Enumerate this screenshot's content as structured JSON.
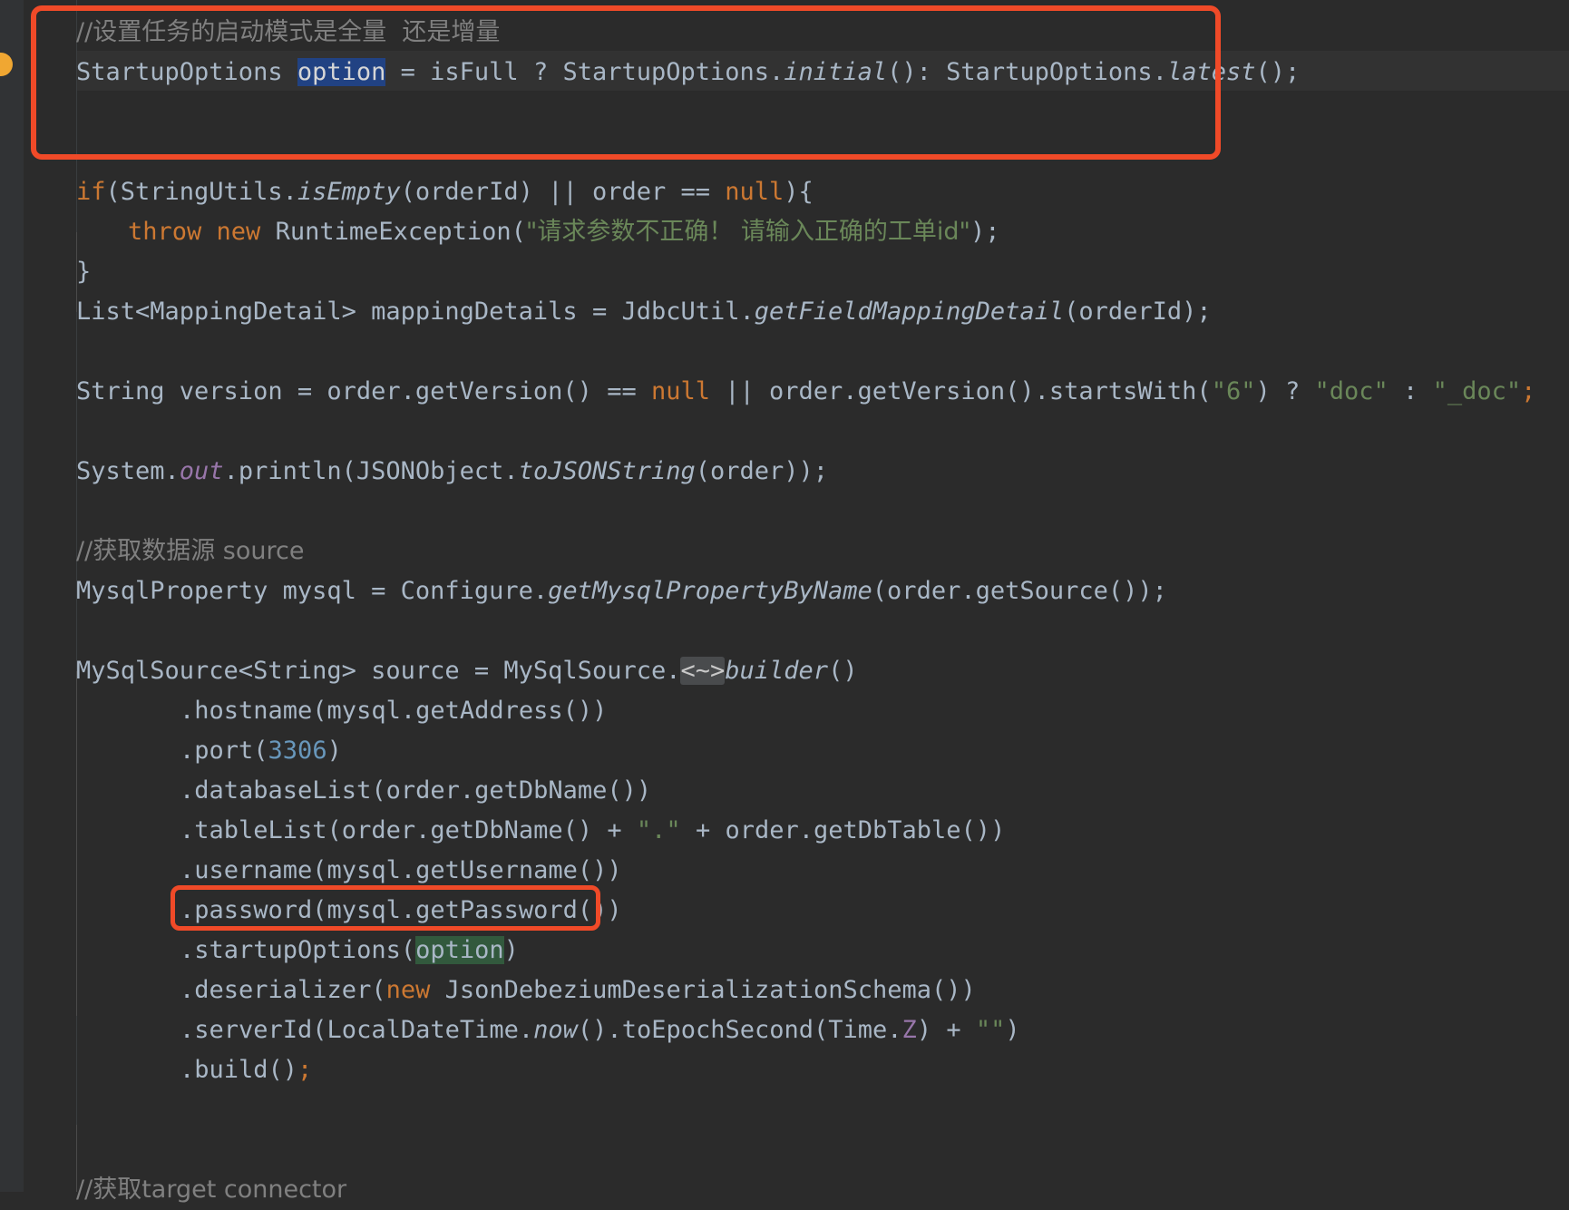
{
  "editor": {
    "theme": "darcula",
    "background": "#2b2b2b",
    "foreground": "#a9b7c6",
    "annotation_color": "#f04a28",
    "selection_color": "#214283",
    "occurrence_color": "#32593d"
  },
  "annotations": [
    {
      "name": "startup-mode-block",
      "label": ""
    },
    {
      "name": "startup-options-call",
      "label": ""
    }
  ],
  "gutter": {
    "intention_bulb_icon": "lightbulb-icon"
  },
  "lines": [
    {
      "indent": 0,
      "tokens": [
        {
          "t": "//设置任务的启动模式是全量  还是增量",
          "c": "cmt"
        }
      ]
    },
    {
      "indent": 0,
      "tokens": [
        {
          "t": "StartupOptions ",
          "c": "ident"
        },
        {
          "t": "option",
          "c": "sel"
        },
        {
          "t": " = isFull ? StartupOptions.",
          "c": "ident"
        },
        {
          "t": "initial",
          "c": "mth"
        },
        {
          "t": "(): StartupOptions.",
          "c": "ident"
        },
        {
          "t": "latest",
          "c": "mth"
        },
        {
          "t": "();",
          "c": "ident"
        }
      ]
    },
    {
      "indent": 0,
      "tokens": []
    },
    {
      "indent": 0,
      "tokens": []
    },
    {
      "indent": 0,
      "tokens": [
        {
          "t": "if",
          "c": "kw"
        },
        {
          "t": "(StringUtils.",
          "c": "ident"
        },
        {
          "t": "isEmpty",
          "c": "mth"
        },
        {
          "t": "(orderId) || order == ",
          "c": "ident"
        },
        {
          "t": "null",
          "c": "kw"
        },
        {
          "t": "){",
          "c": "ident"
        }
      ]
    },
    {
      "indent": 1,
      "tokens": [
        {
          "t": "throw new ",
          "c": "kw"
        },
        {
          "t": "RuntimeException(",
          "c": "ident"
        },
        {
          "t": "\"请求参数不正确！ 请输入正确的工单id\"",
          "c": "str"
        },
        {
          "t": ");",
          "c": "ident"
        }
      ]
    },
    {
      "indent": 0,
      "tokens": [
        {
          "t": "}",
          "c": "ident"
        }
      ]
    },
    {
      "indent": 0,
      "tokens": [
        {
          "t": "List<MappingDetail> mappingDetails = JdbcUtil.",
          "c": "ident"
        },
        {
          "t": "getFieldMappingDetail",
          "c": "mth"
        },
        {
          "t": "(orderId);",
          "c": "ident"
        }
      ]
    },
    {
      "indent": 0,
      "tokens": []
    },
    {
      "indent": 0,
      "tokens": [
        {
          "t": "String version = order.getVersion() == ",
          "c": "ident"
        },
        {
          "t": "null",
          "c": "kw"
        },
        {
          "t": " || order.getVersion().startsWith(",
          "c": "ident"
        },
        {
          "t": "\"6\"",
          "c": "str"
        },
        {
          "t": ") ? ",
          "c": "ident"
        },
        {
          "t": "\"doc\"",
          "c": "str"
        },
        {
          "t": " : ",
          "c": "ident"
        },
        {
          "t": "\"_doc\"",
          "c": "str"
        },
        {
          "t": ";",
          "c": "kw"
        }
      ]
    },
    {
      "indent": 0,
      "tokens": []
    },
    {
      "indent": 0,
      "tokens": [
        {
          "t": "System.",
          "c": "ident"
        },
        {
          "t": "out",
          "c": "stat"
        },
        {
          "t": ".println(JSONObject.",
          "c": "ident"
        },
        {
          "t": "toJSONString",
          "c": "mth"
        },
        {
          "t": "(order));",
          "c": "ident"
        }
      ]
    },
    {
      "indent": 0,
      "tokens": []
    },
    {
      "indent": 0,
      "tokens": [
        {
          "t": "//获取数据源 source",
          "c": "cmt"
        }
      ]
    },
    {
      "indent": 0,
      "tokens": [
        {
          "t": "MysqlProperty mysql = Configure.",
          "c": "ident"
        },
        {
          "t": "getMysqlPropertyByName",
          "c": "mth"
        },
        {
          "t": "(order.getSource());",
          "c": "ident"
        }
      ]
    },
    {
      "indent": 0,
      "tokens": []
    },
    {
      "indent": 0,
      "tokens": [
        {
          "t": "MySqlSource<String> source = MySqlSource.",
          "c": "ident"
        },
        {
          "t": "<~>",
          "c": "hint"
        },
        {
          "t": "builder",
          "c": "mth"
        },
        {
          "t": "()",
          "c": "ident"
        }
      ]
    },
    {
      "indent": 2,
      "tokens": [
        {
          "t": ".hostname(mysql.getAddress())",
          "c": "ident"
        }
      ]
    },
    {
      "indent": 2,
      "tokens": [
        {
          "t": ".port(",
          "c": "ident"
        },
        {
          "t": "3306",
          "c": "num"
        },
        {
          "t": ")",
          "c": "ident"
        }
      ]
    },
    {
      "indent": 2,
      "tokens": [
        {
          "t": ".databaseList(order.getDbName())",
          "c": "ident"
        }
      ]
    },
    {
      "indent": 2,
      "tokens": [
        {
          "t": ".tableList(order.getDbName() + ",
          "c": "ident"
        },
        {
          "t": "\".\"",
          "c": "str"
        },
        {
          "t": " + order.getDbTable())",
          "c": "ident"
        }
      ]
    },
    {
      "indent": 2,
      "tokens": [
        {
          "t": ".username(mysql.getUsername())",
          "c": "ident"
        }
      ]
    },
    {
      "indent": 2,
      "tokens": [
        {
          "t": ".password(mysql.getPassword())",
          "c": "ident"
        }
      ]
    },
    {
      "indent": 2,
      "tokens": [
        {
          "t": ".startupOptions(",
          "c": "ident"
        },
        {
          "t": "option",
          "c": "occ"
        },
        {
          "t": ")",
          "c": "ident"
        }
      ]
    },
    {
      "indent": 2,
      "tokens": [
        {
          "t": ".deserializer(",
          "c": "ident"
        },
        {
          "t": "new ",
          "c": "kw"
        },
        {
          "t": "JsonDebeziumDeserializationSchema())",
          "c": "ident"
        }
      ]
    },
    {
      "indent": 2,
      "tokens": [
        {
          "t": ".serverId(LocalDateTime.",
          "c": "ident"
        },
        {
          "t": "now",
          "c": "mth"
        },
        {
          "t": "().toEpochSecond(Time.",
          "c": "ident"
        },
        {
          "t": "Z",
          "c": "statu"
        },
        {
          "t": ") + ",
          "c": "ident"
        },
        {
          "t": "\"\"",
          "c": "str"
        },
        {
          "t": ")",
          "c": "ident"
        }
      ]
    },
    {
      "indent": 2,
      "tokens": [
        {
          "t": ".build()",
          "c": "ident"
        },
        {
          "t": ";",
          "c": "kw"
        }
      ]
    },
    {
      "indent": 0,
      "tokens": []
    },
    {
      "indent": 0,
      "tokens": []
    },
    {
      "indent": 0,
      "tokens": [
        {
          "t": "//获取target connector",
          "c": "cmt"
        }
      ]
    }
  ]
}
